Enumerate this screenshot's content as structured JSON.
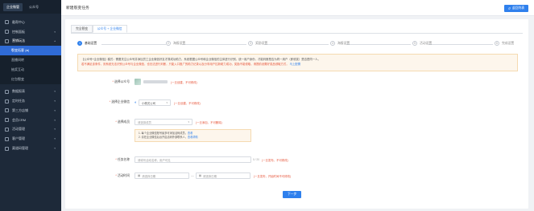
{
  "sidebar": {
    "tabs": [
      {
        "label": "企业微管",
        "active": true
      },
      {
        "label": "公众号",
        "active": false
      }
    ],
    "items": [
      {
        "label": "截帮中心",
        "open": false
      },
      {
        "label": "控制面板",
        "open": false
      },
      {
        "label": "营销玩法",
        "open": true
      }
    ],
    "subitems": [
      {
        "label": "裂变拓客 (●)",
        "active": true
      },
      {
        "label": "直播间转",
        "active": false
      },
      {
        "label": "抽奖互动",
        "active": false
      },
      {
        "label": "红包裂变",
        "active": false
      }
    ],
    "items2": [
      {
        "label": "数据报表"
      },
      {
        "label": "定时任务"
      },
      {
        "label": "第三方店铺"
      },
      {
        "label": "会员CRM"
      },
      {
        "label": "活动管理"
      },
      {
        "label": "客户管理"
      },
      {
        "label": "渠道码管理"
      }
    ]
  },
  "topbar": {
    "title": "新建裂变任务",
    "button": "返回列表"
  },
  "tabs": [
    {
      "label": "完全裂变",
      "active": false
    },
    {
      "label": "公众号 + 企业微信",
      "active": true
    }
  ],
  "steps": [
    {
      "num": "1",
      "label": "基础设置",
      "active": true
    },
    {
      "num": "2",
      "label": "海报设置",
      "active": false
    },
    {
      "num": "3",
      "label": "奖励设置",
      "active": false
    },
    {
      "num": "4",
      "label": "海报设置",
      "active": false
    },
    {
      "num": "5",
      "label": "活动设置",
      "active": false
    },
    {
      "num": "6",
      "label": "完成设置",
      "active": false
    }
  ],
  "notice": {
    "line1": "【公众号+企业微信】模式：需要关注公众号并添加员工企业微信好友才算成功助力，系统根据公众号和企业微信的主体进行识别，统一用户身份，才能判断是否为同一用户（即领奖）是否是同一人。",
    "line2": "若不满足该条件，则系统无法识别公众号与企业微信，也无法进行判断，只能入口推广的助力记录以及分享用户拉新助力成功，奖励不能领取，请提前设置好奖品领取方式，",
    "link": "马上配置"
  },
  "form": {
    "official_account": {
      "label": "选择公众号",
      "hint": "(一旦创建，不可修改)"
    },
    "wecom": {
      "label": "选择企业微信",
      "value": "小精灵公司",
      "hint": "(一旦创建，不可修改)"
    },
    "member": {
      "label": "选择成员",
      "placeholder": "请选择成员",
      "hint": "(一旦添加，不可删除)"
    },
    "tips": [
      {
        "text": "1. 每个企业微信账号最多可添加活码成员，",
        "link": "查看"
      },
      {
        "text": "2. 请在企业微信后台开启活码外部联系人，",
        "link": "查看帮助"
      }
    ],
    "task_name": {
      "label": "任务名称",
      "placeholder": "请填写活动名称，用户可见",
      "counter": "0 / 20",
      "hint": "(一旦发布，不可修改)"
    },
    "time": {
      "label": "活动时间",
      "start_placeholder": "请选择日期",
      "end_placeholder": "请选择日期",
      "hint": "(一旦发布，开始时间不可修改)"
    },
    "next_button": "下一步"
  }
}
